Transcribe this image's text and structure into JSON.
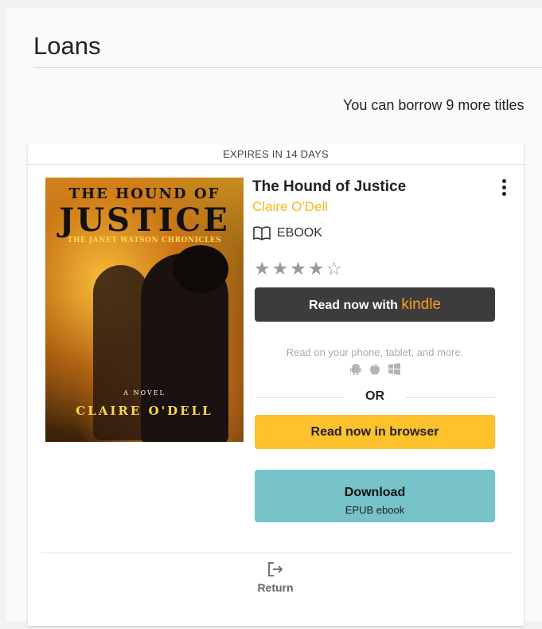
{
  "page": {
    "title": "Loans",
    "borrow_message": "You can borrow 9 more titles"
  },
  "loan": {
    "expires": "EXPIRES IN 14 DAYS",
    "title": "The Hound of Justice",
    "author": "Claire O'Dell",
    "format": "EBOOK",
    "rating": {
      "filled": 4,
      "total": 5
    },
    "cover": {
      "line1": "THE HOUND OF",
      "line2": "JUSTICE",
      "series": "THE JANET WATSON CHRONICLES",
      "novel": "A NOVEL",
      "author": "CLAIRE O'DELL"
    },
    "kindle_button": {
      "prefix": "Read now with",
      "brand": "kindle"
    },
    "read_anywhere": "Read on your phone, tablet, and more.",
    "platforms": [
      "android-icon",
      "apple-icon",
      "windows-icon"
    ],
    "or_label": "OR",
    "browser_button": "Read now in browser",
    "download_button": {
      "label": "Download",
      "sub": "EPUB ebook"
    },
    "return_label": "Return"
  },
  "colors": {
    "author": "#f2b81c",
    "kindle_button": "#3c3c3c",
    "kindle_brand": "#ff9f1a",
    "browser_button": "#fdc22c",
    "download_button": "#76c2c8"
  }
}
